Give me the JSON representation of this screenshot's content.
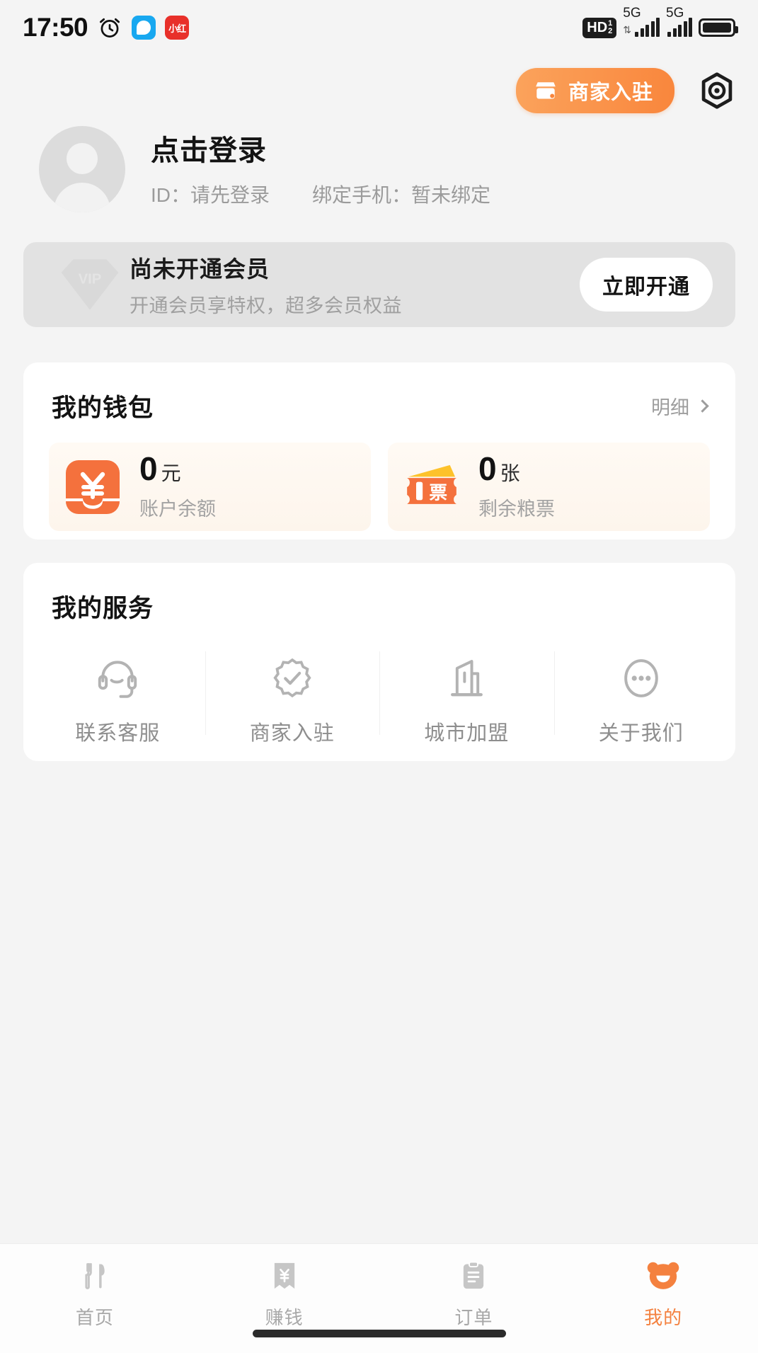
{
  "status_bar": {
    "time": "17:50",
    "alarm_icon": "alarm-clock-icon",
    "app_icon_blue": "chat-app-icon",
    "app_icon_red_label": "小红",
    "hd_label": "HD",
    "hd_sub_top": "1",
    "hd_sub_bottom": "2",
    "network_1": "5G",
    "network_2": "5G",
    "battery_icon": "battery-icon"
  },
  "top_actions": {
    "merchant_button_label": "商家入驻",
    "merchant_button_icon": "storefront-icon",
    "settings_icon": "hexagon-settings-icon",
    "accent_color": "#f9863c"
  },
  "profile": {
    "avatar_icon": "default-avatar-icon",
    "login_prompt": "点击登录",
    "id_text": "ID：请先登录",
    "phone_text": "绑定手机：暂未绑定"
  },
  "vip_card": {
    "badge_icon": "vip-diamond-icon",
    "title": "尚未开通会员",
    "description": "开通会员享特权，超多会员权益",
    "button_label": "立即开通",
    "background_color": "#e2e2e2"
  },
  "wallet": {
    "title": "我的钱包",
    "detail_label": "明细",
    "items": [
      {
        "icon": "wallet-yuan-icon",
        "amount": "0",
        "unit": "元",
        "label": "账户余额"
      },
      {
        "icon": "food-coupon-icon",
        "amount": "0",
        "unit": "张",
        "label": "剩余粮票"
      }
    ]
  },
  "services": {
    "title": "我的服务",
    "items": [
      {
        "icon": "headset-support-icon",
        "label": "联系客服"
      },
      {
        "icon": "verified-badge-icon",
        "label": "商家入驻"
      },
      {
        "icon": "city-building-icon",
        "label": "城市加盟"
      },
      {
        "icon": "ellipsis-circle-icon",
        "label": "关于我们"
      }
    ]
  },
  "tabbar": {
    "active_color": "#f4813f",
    "inactive_color": "#a8a8a8",
    "tabs": [
      {
        "icon": "cutlery-icon",
        "label": "首页",
        "active": false
      },
      {
        "icon": "earn-money-receipt-icon",
        "label": "赚钱",
        "active": false
      },
      {
        "icon": "order-clipboard-icon",
        "label": "订单",
        "active": false
      },
      {
        "icon": "bear-face-icon",
        "label": "我的",
        "active": true
      }
    ]
  }
}
